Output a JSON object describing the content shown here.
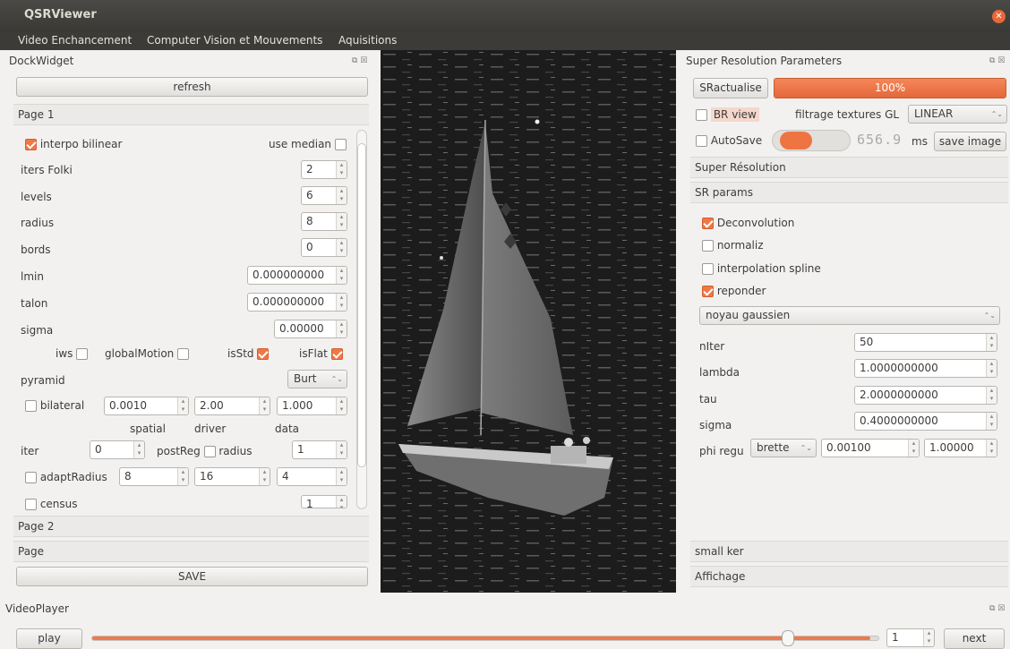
{
  "window": {
    "title": "QSRViewer"
  },
  "menu": [
    "Video Enchancement",
    "Computer Vision et Mouvements",
    "Aquisitions"
  ],
  "left_dock": {
    "title": "DockWidget",
    "refresh_label": "refresh",
    "page1_label": "Page 1",
    "interpo_bilinear": {
      "label": "interpo bilinear",
      "checked": true
    },
    "use_median": {
      "label": "use median",
      "checked": false
    },
    "params": [
      {
        "label": "iters Folki",
        "value": "2"
      },
      {
        "label": "levels",
        "value": "6"
      },
      {
        "label": "radius",
        "value": "8"
      },
      {
        "label": "bords",
        "value": "0"
      },
      {
        "label": "lmin",
        "value": "0.000000000"
      },
      {
        "label": "talon",
        "value": "0.000000000"
      },
      {
        "label": "sigma",
        "value": "0.00000"
      }
    ],
    "iws_label": "iws",
    "globalmotion_label": "globalMotion",
    "isstd_label": "isStd",
    "isflat_label": "isFlat",
    "pyramid_label": "pyramid",
    "pyramid_value": "Burt",
    "bilateral_label": "bilateral",
    "bilateral_values": [
      "0.0010",
      "2.00",
      "1.000"
    ],
    "bilateral_captions": [
      "spatial",
      "driver",
      "data"
    ],
    "iter_label": "iter",
    "iter_value": "0",
    "postreg_label": "postReg",
    "radius2_label": "radius",
    "radius2_value": "1",
    "adaptradius_label": "adaptRadius",
    "adaptradius_values": [
      "8",
      "16",
      "4"
    ],
    "census_label": "census",
    "census_value": "1",
    "page2_label": "Page 2",
    "page_label": "Page",
    "save_label": "SAVE"
  },
  "right_dock": {
    "title": "Super Resolution Parameters",
    "sractualise_label": "SRactualise",
    "progress_text": "100%",
    "progress_value": 1.0,
    "brview_label": "BR view",
    "filtrage_label": "filtrage textures GL",
    "filtrage_value": "LINEAR",
    "autosave_label": "AutoSave",
    "lcd_value": "656.9",
    "ms_label": "ms",
    "save_image_label": "save image",
    "super_resolution_label": "Super Résolution",
    "sr_params_label": "SR params",
    "checks": [
      {
        "label": "Deconvolution",
        "checked": true
      },
      {
        "label": "normaliz",
        "checked": false
      },
      {
        "label": "interpolation spline",
        "checked": false
      },
      {
        "label": "reponder",
        "checked": true
      }
    ],
    "kernel_value": "noyau gaussien",
    "params": [
      {
        "label": "nIter",
        "value": "50"
      },
      {
        "label": "lambda",
        "value": "1.0000000000"
      },
      {
        "label": "tau",
        "value": "2.0000000000"
      },
      {
        "label": "sigma",
        "value": "0.4000000000"
      }
    ],
    "phi_regu_label": "phi regu",
    "phi_regu_combo": "brette",
    "phi_regu_values": [
      "0.00100",
      "1.00000"
    ],
    "small_ker_label": "small ker",
    "affichage_label": "Affichage"
  },
  "video_player": {
    "title": "VideoPlayer",
    "play_label": "play",
    "position": 0.99,
    "frame_value": "1",
    "next_label": "next"
  },
  "colors": {
    "accent": "#f07746",
    "titlebar": "#3c3b37"
  }
}
